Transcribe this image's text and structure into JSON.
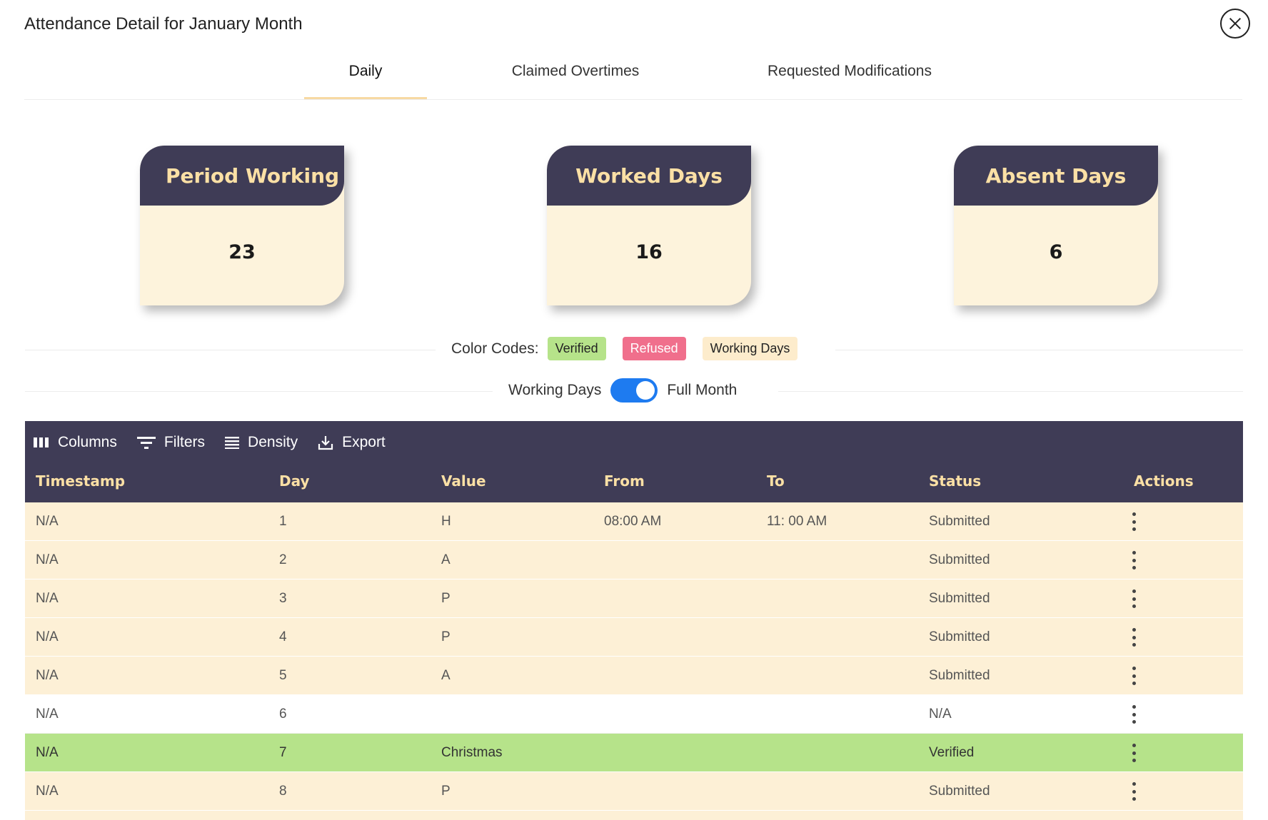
{
  "dialog": {
    "title": "Attendance Detail for January Month"
  },
  "tabs": [
    {
      "label": "Daily",
      "active": true
    },
    {
      "label": "Claimed Overtimes",
      "active": false
    },
    {
      "label": "Requested Modifications",
      "active": false
    }
  ],
  "cards": [
    {
      "title": "Period Working",
      "value": "23"
    },
    {
      "title": "Worked Days",
      "value": "16"
    },
    {
      "title": "Absent Days",
      "value": "6"
    }
  ],
  "color_codes": {
    "label": "Color Codes:",
    "verified": "Verified",
    "refused": "Refused",
    "working": "Working Days"
  },
  "view_toggle": {
    "left_label": "Working Days",
    "right_label": "Full Month",
    "state": "Full Month"
  },
  "toolbar": {
    "columns": "Columns",
    "filters": "Filters",
    "density": "Density",
    "export": "Export"
  },
  "table": {
    "headers": [
      "Timestamp",
      "Day",
      "Value",
      "From",
      "To",
      "Status",
      "Actions"
    ],
    "rows": [
      {
        "timestamp": "N/A",
        "day": "1",
        "value": "H",
        "from": "08:00 AM",
        "to": "11: 00 AM",
        "status": "Submitted",
        "type": "working"
      },
      {
        "timestamp": "N/A",
        "day": "2",
        "value": "A",
        "from": "",
        "to": "",
        "status": "Submitted",
        "type": "working"
      },
      {
        "timestamp": "N/A",
        "day": "3",
        "value": "P",
        "from": "",
        "to": "",
        "status": "Submitted",
        "type": "working"
      },
      {
        "timestamp": "N/A",
        "day": "4",
        "value": "P",
        "from": "",
        "to": "",
        "status": "Submitted",
        "type": "working"
      },
      {
        "timestamp": "N/A",
        "day": "5",
        "value": "A",
        "from": "",
        "to": "",
        "status": "Submitted",
        "type": "working"
      },
      {
        "timestamp": "N/A",
        "day": "6",
        "value": "",
        "from": "",
        "to": "",
        "status": "N/A",
        "type": "plain"
      },
      {
        "timestamp": "N/A",
        "day": "7",
        "value": "Christmas",
        "from": "",
        "to": "",
        "status": "Verified",
        "type": "verified"
      },
      {
        "timestamp": "N/A",
        "day": "8",
        "value": "P",
        "from": "",
        "to": "",
        "status": "Submitted",
        "type": "working"
      },
      {
        "timestamp": "",
        "day": "",
        "value": "",
        "from": "",
        "to": "",
        "status": "",
        "type": "working"
      }
    ]
  },
  "colors": {
    "header_bg": "#3f3c56",
    "header_text": "#fbe0a5",
    "card_body": "#fdf3dc",
    "verified": "#b6e38a",
    "refused": "#f06f8c",
    "working": "#fdf0d6",
    "toggle": "#1e7bf0",
    "tab_indicator": "#f7d9a3"
  }
}
